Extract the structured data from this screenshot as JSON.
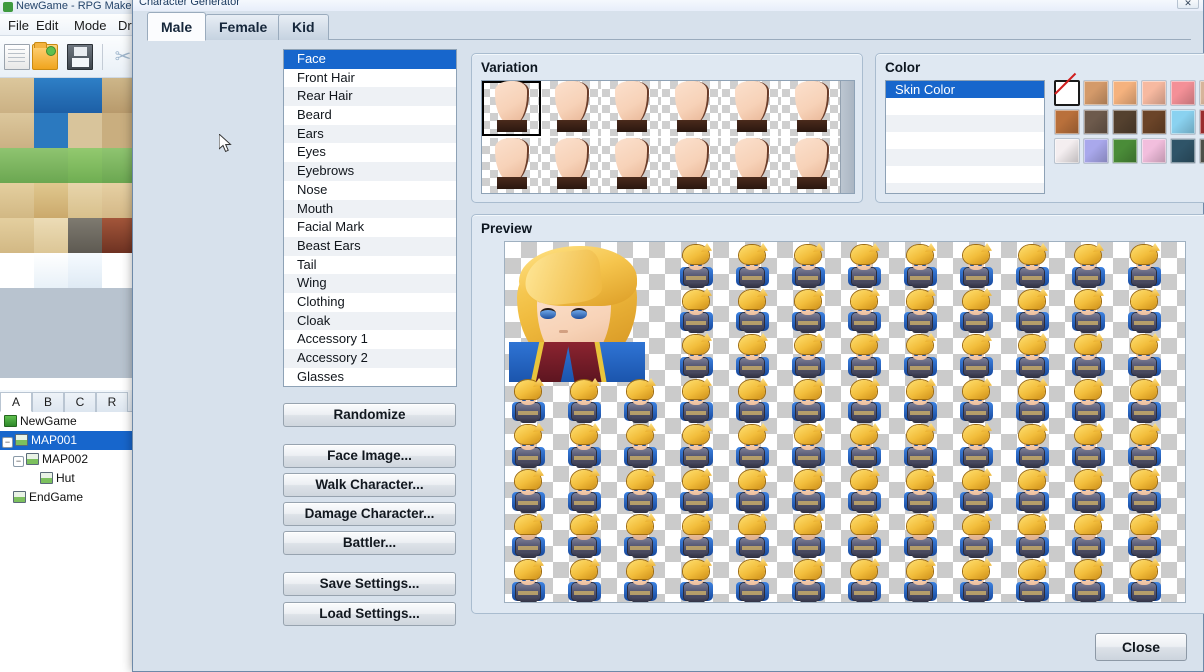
{
  "editor": {
    "title": "NewGame - RPG Maker MV",
    "menus": [
      "File",
      "Edit",
      "Mode",
      "Draw"
    ],
    "toolbar_icons": [
      "new-document-icon",
      "open-folder-icon",
      "save-disk-icon",
      "cut-scissors-icon"
    ],
    "layer_tabs": [
      "A",
      "B",
      "C",
      "R"
    ],
    "active_layer_tab": "A",
    "map_tree": [
      {
        "label": "NewGame",
        "indent": 0,
        "icon": "project-icon",
        "selected": false,
        "expander": ""
      },
      {
        "label": "MAP001",
        "indent": 0,
        "icon": "map-icon",
        "selected": true,
        "expander": "-"
      },
      {
        "label": "MAP002",
        "indent": 1,
        "icon": "map-icon",
        "selected": false,
        "expander": "-"
      },
      {
        "label": "Hut",
        "indent": 2,
        "icon": "map-icon",
        "selected": false,
        "expander": ""
      },
      {
        "label": "EndGame",
        "indent": 1,
        "icon": "map-icon",
        "selected": false,
        "expander": ""
      }
    ]
  },
  "dialog": {
    "title": "Character Generator",
    "close_x_label": "✕",
    "tabs": [
      {
        "label": "Male",
        "active": true
      },
      {
        "label": "Female",
        "active": false
      },
      {
        "label": "Kid",
        "active": false
      }
    ],
    "parts": [
      {
        "label": "Face",
        "selected": true
      },
      {
        "label": "Front Hair",
        "selected": false
      },
      {
        "label": "Rear Hair",
        "selected": false
      },
      {
        "label": "Beard",
        "selected": false
      },
      {
        "label": "Ears",
        "selected": false
      },
      {
        "label": "Eyes",
        "selected": false
      },
      {
        "label": "Eyebrows",
        "selected": false
      },
      {
        "label": "Nose",
        "selected": false
      },
      {
        "label": "Mouth",
        "selected": false
      },
      {
        "label": "Facial Mark",
        "selected": false
      },
      {
        "label": "Beast Ears",
        "selected": false
      },
      {
        "label": "Tail",
        "selected": false
      },
      {
        "label": "Wing",
        "selected": false
      },
      {
        "label": "Clothing",
        "selected": false
      },
      {
        "label": "Cloak",
        "selected": false
      },
      {
        "label": "Accessory 1",
        "selected": false
      },
      {
        "label": "Accessory 2",
        "selected": false
      },
      {
        "label": "Glasses",
        "selected": false
      }
    ],
    "buttons": {
      "randomize": "Randomize",
      "face_image": "Face Image...",
      "walk_character": "Walk Character...",
      "damage_character": "Damage Character...",
      "battler": "Battler...",
      "save_settings": "Save Settings...",
      "load_settings": "Load Settings..."
    },
    "variation": {
      "title": "Variation",
      "columns": 6,
      "rows": 2,
      "selected_index": 0,
      "count": 12,
      "has_scrollbar": true
    },
    "color": {
      "title": "Color",
      "list": [
        {
          "label": "Skin Color",
          "selected": true
        }
      ],
      "empty_rows": 6,
      "swatches": [
        {
          "name": "none",
          "hex": "#ffffff"
        },
        {
          "name": "tan-medium",
          "hex": "#d49a6a"
        },
        {
          "name": "peach",
          "hex": "#f5b27e"
        },
        {
          "name": "light-peach",
          "hex": "#f7b9a0"
        },
        {
          "name": "pink",
          "hex": "#f49097"
        },
        {
          "name": "beige",
          "hex": "#d6b49a"
        },
        {
          "name": "brown-orange",
          "hex": "#b9703b"
        },
        {
          "name": "gray-brown",
          "hex": "#6d5a4c"
        },
        {
          "name": "dark-brown",
          "hex": "#54412f"
        },
        {
          "name": "deep-brown",
          "hex": "#6b4428"
        },
        {
          "name": "sky-blue",
          "hex": "#8ad2f0"
        },
        {
          "name": "dark-red",
          "hex": "#9a2d2d"
        },
        {
          "name": "white-pink",
          "hex": "#f4eef0"
        },
        {
          "name": "periwinkle",
          "hex": "#a9a8ec"
        },
        {
          "name": "green",
          "hex": "#4a8c38"
        },
        {
          "name": "light-pink",
          "hex": "#f2bedd"
        },
        {
          "name": "slate-blue",
          "hex": "#2f5468"
        },
        {
          "name": "dark-gray",
          "hex": "#4e5049"
        }
      ]
    },
    "preview": {
      "title": "Preview",
      "portrait": {
        "hair_hex": "#f2bd3b",
        "eye_hex": "#2f6fc7",
        "coat_hex": "#1f5bb5",
        "collar_hex": "#7d2130"
      },
      "sprite_rows": 8,
      "sprite_columns": 12
    },
    "close_label": "Close"
  }
}
